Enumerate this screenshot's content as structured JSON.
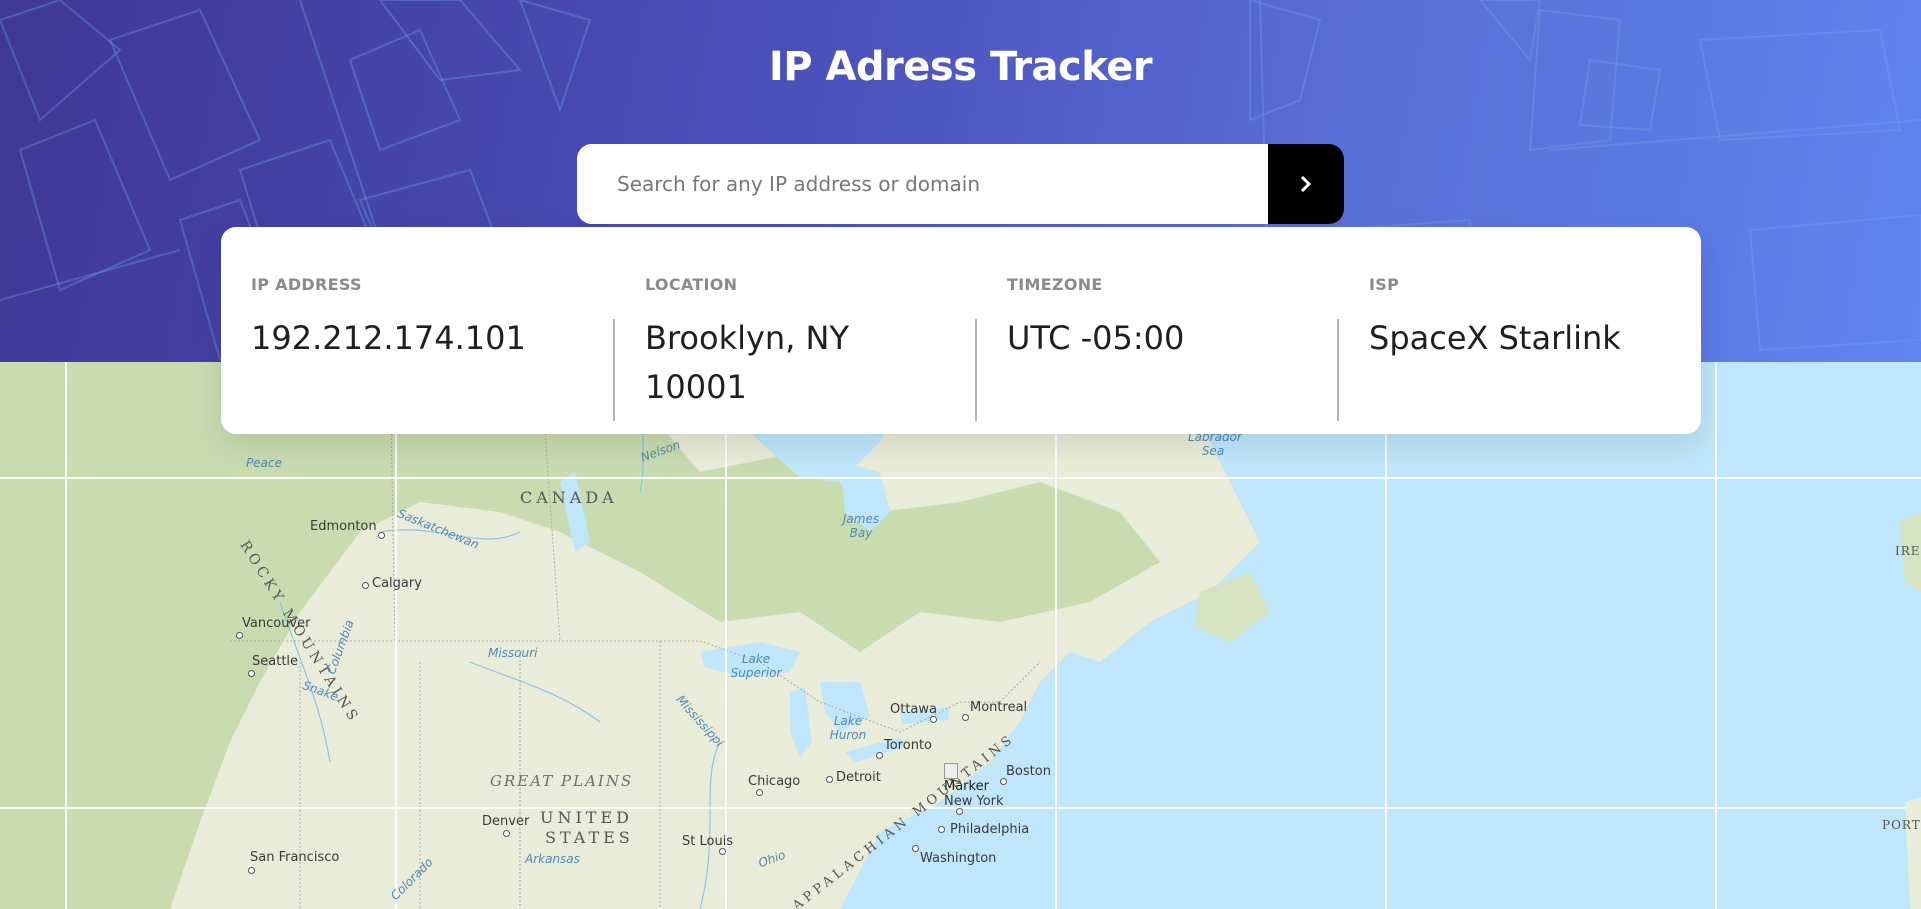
{
  "header": {
    "title": "IP Adress Tracker",
    "search": {
      "placeholder": "Search for any IP address or domain",
      "value": "",
      "button_icon": "chevron-right-icon"
    }
  },
  "info": {
    "items": [
      {
        "label": "IP ADDRESS",
        "value": "192.212.174.101"
      },
      {
        "label": "LOCATION",
        "value": "Brooklyn, NY 10001"
      },
      {
        "label": "TIMEZONE",
        "value": "UTC -05:00"
      },
      {
        "label": "ISP",
        "value": "SpaceX Starlink"
      }
    ]
  },
  "map": {
    "marker_alt": "Marker",
    "labels": {
      "canada": "CANADA",
      "rocky": "ROCKY MOUNTAINS",
      "great_plains": "GREAT PLAINS",
      "united": "UNITED",
      "states": "STATES",
      "appalachian": "APPALACHIAN MOUNTAINS",
      "edmonton": "Edmonton",
      "calgary": "Calgary",
      "vancouver": "Vancouver",
      "seattle": "Seattle",
      "san_francisco": "San Francisco",
      "denver": "Denver",
      "chicago": "Chicago",
      "detroit": "Detroit",
      "toronto": "Toronto",
      "ottawa": "Ottawa",
      "montreal": "Montreal",
      "boston": "Boston",
      "new_york": "New York",
      "philadelphia": "Philadelphia",
      "washington": "Washington",
      "st_louis": "St Louis",
      "peace": "Peace",
      "nelson": "Nelson",
      "saskatchewan": "Saskatchewan",
      "james_bay": "James Bay",
      "labrador_sea": "Labrador Sea",
      "missouri": "Missouri",
      "lake_superior": "Lake Superior",
      "lake_huron": "Lake Huron",
      "mississippi": "Mississippi",
      "columbia": "Columbia",
      "snake": "Snake",
      "colorado": "Colorado",
      "arkansas": "Arkansas",
      "ohio": "Ohio",
      "ire": "IRE",
      "port": "PORT"
    },
    "colors": {
      "ocean": "#bfe6fb",
      "land": "#e9ecd8",
      "forest": "#c7dbac",
      "grid": "#ffffff"
    }
  }
}
